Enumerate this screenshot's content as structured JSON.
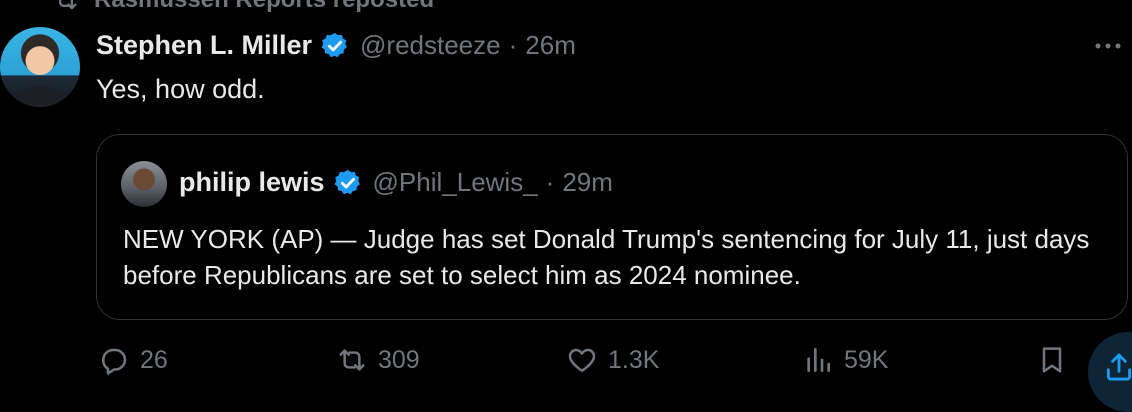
{
  "repost": {
    "label": "Rasmussen Reports reposted"
  },
  "tweet": {
    "author_name": "Stephen L. Miller",
    "author_handle": "@redsteeze",
    "separator": "·",
    "time": "26m",
    "text": "Yes, how odd."
  },
  "quote": {
    "author_name": "philip lewis",
    "author_handle": "@Phil_Lewis_",
    "separator": "·",
    "time": "29m",
    "text": "NEW YORK (AP) — Judge has set Donald Trump's sentencing for July 11, just days before Republicans are set to select him as 2024 nominee."
  },
  "actions": {
    "replies": "26",
    "reposts": "309",
    "likes": "1.3K",
    "views": "59K"
  },
  "icons": {
    "repost": "repost-icon",
    "verified": "verified-badge-icon",
    "more": "more-icon",
    "reply": "reply-icon",
    "retweet": "retweet-icon",
    "like": "heart-icon",
    "views": "views-icon",
    "bookmark": "bookmark-icon",
    "share": "share-icon"
  },
  "colors": {
    "background": "#000000",
    "text": "#e7e9ea",
    "muted": "#71767b",
    "verified": "#1d9bf0",
    "border": "#2f3336"
  }
}
